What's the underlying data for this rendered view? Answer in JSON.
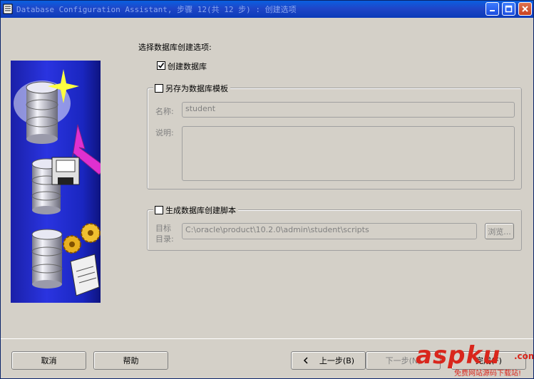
{
  "window": {
    "title": "Database Configuration Assistant, 步骤 12(共 12 步) : 创建选项"
  },
  "content": {
    "heading": "选择数据库创建选项:",
    "create_db": {
      "label": "创建数据库",
      "checked": true
    },
    "template_group": {
      "label": "另存为数据库模板",
      "checked": false,
      "name_label": "名称:",
      "name_value": "student",
      "desc_label": "说明:",
      "desc_value": ""
    },
    "script_group": {
      "label": "生成数据库创建脚本",
      "checked": false,
      "dest_label_line1": "目标",
      "dest_label_line2": "目录:",
      "dest_value": "C:\\oracle\\product\\10.2.0\\admin\\student\\scripts",
      "browse_label": "浏览..."
    }
  },
  "footer": {
    "cancel_label": "取消",
    "help_label": "帮助",
    "back_label": "上一步(B)",
    "next_label": "下一步(N)",
    "finish_label": "完成(F)"
  },
  "watermark": {
    "brand": "aspku",
    "brand_suffix": ".com",
    "tagline": "免费网站源码下载站!"
  },
  "icons": {
    "title": "app-window-icon",
    "minimize": "minimize-icon",
    "maximize": "maximize-icon",
    "close": "close-icon",
    "back": "chevron-left-icon"
  }
}
